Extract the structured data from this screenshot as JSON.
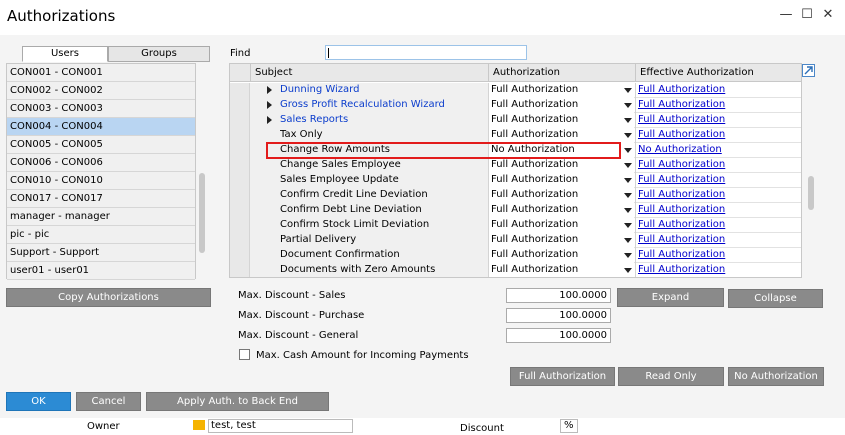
{
  "window": {
    "title": "Authorizations",
    "minimize_glyph": "—",
    "maximize_glyph": "☐",
    "close_glyph": "✕"
  },
  "tabs": {
    "users": "Users",
    "groups": "Groups"
  },
  "users": [
    "CON001 - CON001",
    "CON002 - CON002",
    "CON003 - CON003",
    "CON004 - CON004",
    "CON005 - CON005",
    "CON006 - CON006",
    "CON010 - CON010",
    "CON017 - CON017",
    "manager - manager",
    "pic - pic",
    "Support - Support",
    "user01 - user01"
  ],
  "selected_user_index": 3,
  "find": {
    "label": "Find",
    "value": ""
  },
  "grid": {
    "headers": {
      "subject": "Subject",
      "authorization": "Authorization",
      "effective": "Effective Authorization"
    },
    "rows": [
      {
        "subject": "Dunning Wizard",
        "auth": "Full Authorization",
        "eff": "Full Authorization",
        "expandable": true
      },
      {
        "subject": "Gross Profit Recalculation Wizard",
        "auth": "Full Authorization",
        "eff": "Full Authorization",
        "expandable": true
      },
      {
        "subject": "Sales Reports",
        "auth": "Full Authorization",
        "eff": "Full Authorization",
        "expandable": true
      },
      {
        "subject": "Tax Only",
        "auth": "Full Authorization",
        "eff": "Full Authorization",
        "expandable": false
      },
      {
        "subject": "Change Row Amounts",
        "auth": "No Authorization",
        "eff": "No Authorization",
        "expandable": false
      },
      {
        "subject": "Change Sales Employee",
        "auth": "Full Authorization",
        "eff": "Full Authorization",
        "expandable": false
      },
      {
        "subject": "Sales Employee Update",
        "auth": "Full Authorization",
        "eff": "Full Authorization",
        "expandable": false
      },
      {
        "subject": "Confirm Credit Line Deviation",
        "auth": "Full Authorization",
        "eff": "Full Authorization",
        "expandable": false
      },
      {
        "subject": "Confirm Debt Line Deviation",
        "auth": "Full Authorization",
        "eff": "Full Authorization",
        "expandable": false
      },
      {
        "subject": "Confirm Stock Limit Deviation",
        "auth": "Full Authorization",
        "eff": "Full Authorization",
        "expandable": false
      },
      {
        "subject": "Partial Delivery",
        "auth": "Full Authorization",
        "eff": "Full Authorization",
        "expandable": false
      },
      {
        "subject": "Document Confirmation",
        "auth": "Full Authorization",
        "eff": "Full Authorization",
        "expandable": false
      },
      {
        "subject": "Documents with Zero Amounts",
        "auth": "Full Authorization",
        "eff": "Full Authorization",
        "expandable": false
      }
    ]
  },
  "buttons": {
    "copy_authorizations": "Copy Authorizations",
    "expand": "Expand",
    "collapse": "Collapse",
    "full_authorization": "Full Authorization",
    "read_only": "Read Only",
    "no_authorization": "No Authorization",
    "ok": "OK",
    "cancel": "Cancel",
    "apply_auth": "Apply Auth. to Back End"
  },
  "discounts": {
    "sales_label": "Max. Discount - Sales",
    "sales_value": "100.0000",
    "purchase_label": "Max. Discount - Purchase",
    "purchase_value": "100.0000",
    "general_label": "Max. Discount - General",
    "general_value": "100.0000"
  },
  "cash": {
    "label": "Max. Cash Amount for Incoming Payments",
    "checked": false
  },
  "background": {
    "owner_label": "Owner",
    "owner_value": "test, test",
    "discount_label": "Discount",
    "percent": "%"
  },
  "colors": {
    "accent_blue": "#2c8bd4",
    "highlight_red": "#e21b1b",
    "selected_row": "#b9d5f2",
    "link": "#0000cc"
  }
}
